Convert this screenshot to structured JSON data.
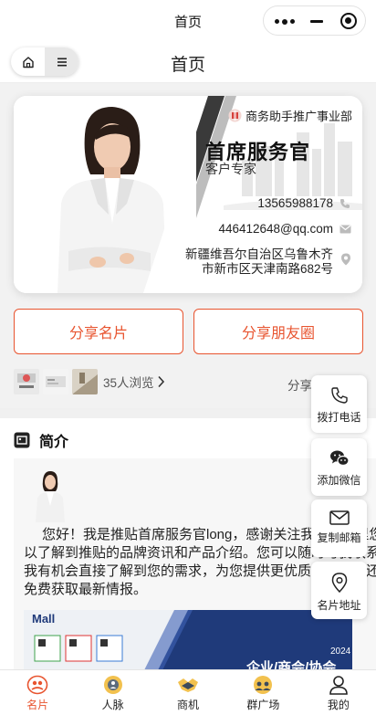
{
  "system": {
    "title": "首页"
  },
  "nav": {
    "title": "首页",
    "home_icon": "home-icon",
    "menu_icon": "menu-icon"
  },
  "card": {
    "company": "商务助手推广事业部",
    "name": "首席服务官",
    "position": "客户专家",
    "phone": "13565988178",
    "email": "446412648@qq.com",
    "address": "新疆维吾尔自治区乌鲁木齐市新市区天津南路682号"
  },
  "buttons": {
    "share_card": "分享名片",
    "share_moments": "分享朋友圈"
  },
  "viewers": {
    "count_text": "35人浏览",
    "share_label": "分享"
  },
  "intro": {
    "heading": "简介",
    "text": "您好！我是推贴首席服务官long，感谢关注我，在这里您可以了解到推贴的品牌资讯和产品介绍。您可以随时与我联系，让我有机会直接了解到您的需求，为您提供更优质的服务，还可以免费获取最新情报。",
    "banner_logo": "Mall",
    "banner_year": "2024",
    "banner_text": "企业/商会/协会"
  },
  "fabs": [
    {
      "label": "拨打电话",
      "icon": "phone-icon"
    },
    {
      "label": "添加微信",
      "icon": "wechat-icon"
    },
    {
      "label": "复制邮箱",
      "icon": "mail-icon"
    },
    {
      "label": "名片地址",
      "icon": "location-icon"
    }
  ],
  "tabs": [
    {
      "label": "名片",
      "icon": "card-icon",
      "active": true
    },
    {
      "label": "人脉",
      "icon": "network-icon",
      "active": false
    },
    {
      "label": "商机",
      "icon": "handshake-icon",
      "active": false
    },
    {
      "label": "群广场",
      "icon": "group-icon",
      "active": false
    },
    {
      "label": "我的",
      "icon": "user-icon",
      "active": false
    }
  ],
  "colors": {
    "accent": "#e8542f",
    "background": "#f2f2f2"
  }
}
